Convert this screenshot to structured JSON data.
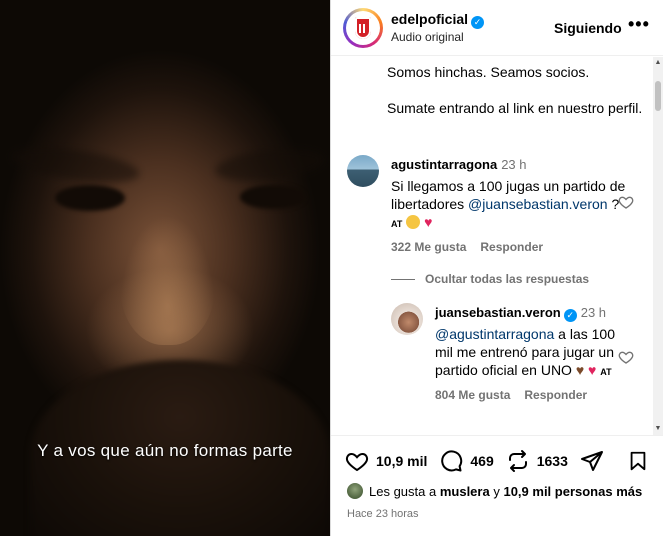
{
  "media": {
    "subtitle": "Y a vos que aún no formas parte"
  },
  "header": {
    "username": "edelpoficial",
    "audio": "Audio original",
    "follow_label": "Siguiendo",
    "more_label": "•••"
  },
  "caption": {
    "lines": [
      "Somos hinchas. Seamos socios.",
      "Sumate entrando al link en nuestro perfil."
    ]
  },
  "comments": [
    {
      "username": "agustintarragona",
      "time": "23 h",
      "text_before": "Si llegamos a 100 jugas un partido de libertadores ",
      "mention": "@juansebastian.veron",
      "text_after": " ? ",
      "emoji_at": "AT",
      "likes": "322 Me gusta",
      "reply_label": "Responder"
    },
    {
      "username": "juansebastian.veron",
      "time": "23 h",
      "mention": "@agustintarragona",
      "text_after": " a las 100 mil me entrenó para jugar un partido oficial en UNO ",
      "emoji_at": "AT",
      "likes": "804 Me gusta",
      "reply_label": "Responder"
    }
  ],
  "hide_replies": "Ocultar todas las respuestas",
  "footer": {
    "like_count": "10,9 mil",
    "comment_count": "469",
    "repost_count": "1633",
    "likes_prefix": "Les gusta a ",
    "likes_user": "muslera",
    "likes_mid": " y ",
    "likes_rest": "10,9 mil personas más",
    "posted": "Hace 23 horas"
  },
  "colors": {
    "mention": "#00376b",
    "verified": "#0095f6",
    "muted": "#737373"
  }
}
